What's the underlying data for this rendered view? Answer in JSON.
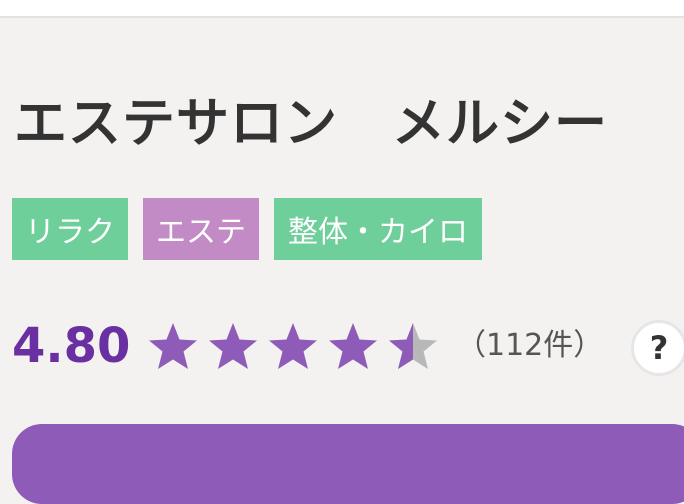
{
  "header": {
    "title": "エステサロン　メルシー"
  },
  "tags": [
    {
      "label": "リラク",
      "color": "#6fcf9a"
    },
    {
      "label": "エステ",
      "color": "#c38bc5"
    },
    {
      "label": "整体・カイロ",
      "color": "#6fcf9a"
    }
  ],
  "rating": {
    "value": "4.80",
    "stars": 4.5,
    "max_stars": 5,
    "review_count": "（112件）",
    "help_label": "?"
  },
  "colors": {
    "accent": "#6a2fa0",
    "star": "#8e5cb8",
    "star_empty": "#b8b8b8",
    "button": "#8e5cb8"
  },
  "icons": {
    "star": "star-icon",
    "help": "question-icon"
  }
}
